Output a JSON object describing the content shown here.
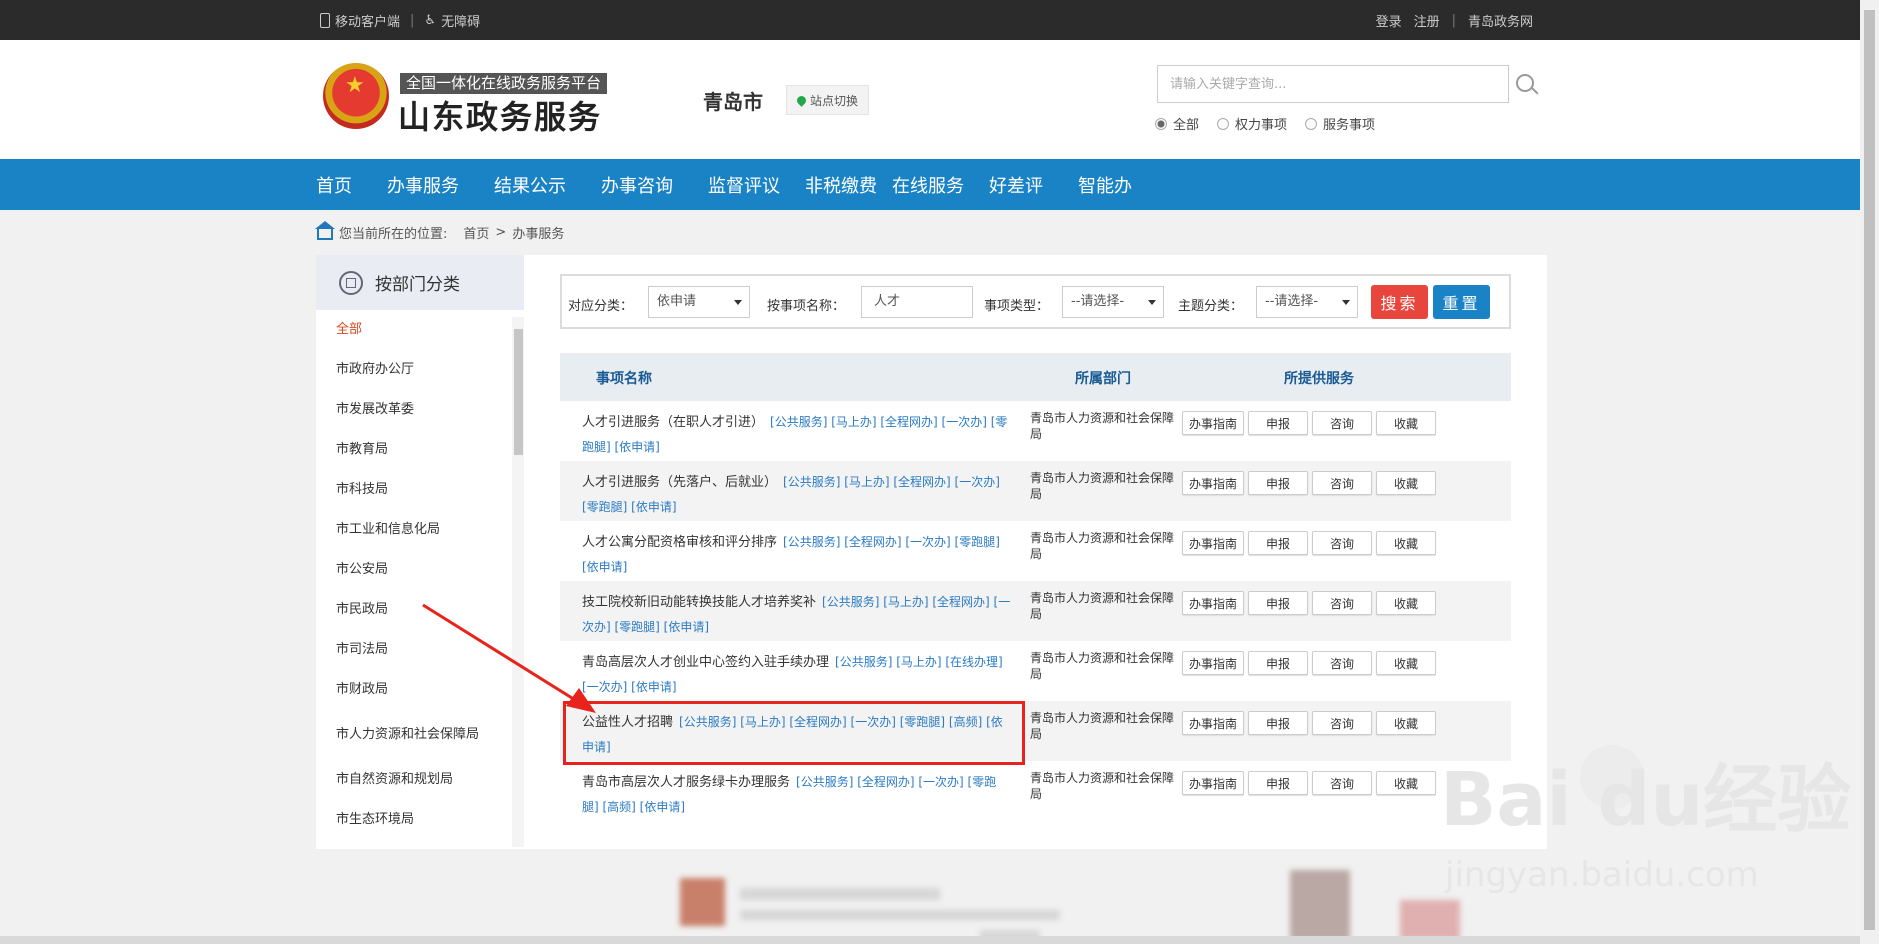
{
  "topbar": {
    "mobile_label": "移动客户端",
    "accessibility_label": "无障碍",
    "login": "登录",
    "register": "注册",
    "portal": "青岛政务网"
  },
  "header": {
    "logo_sub": "全国一体化在线政务服务平台",
    "logo_main": "山东政务服务",
    "city": "青岛市",
    "site_switch": "站点切换",
    "search_placeholder": "请输入关键字查询...",
    "radios": [
      {
        "label": "全部",
        "checked": true
      },
      {
        "label": "权力事项",
        "checked": false
      },
      {
        "label": "服务事项",
        "checked": false
      }
    ]
  },
  "nav": [
    "首页",
    "办事服务",
    "结果公示",
    "办事咨询",
    "监督评议",
    "非税缴费",
    "在线服务",
    "好差评",
    "智能办"
  ],
  "breadcrumb": {
    "prefix": "您当前所在的位置:",
    "home": "首页",
    "sep": ">",
    "current": "办事服务"
  },
  "sidebar": {
    "title": "按部门分类",
    "items": [
      "全部",
      "市政府办公厅",
      "市发展改革委",
      "市教育局",
      "市科技局",
      "市工业和信息化局",
      "市公安局",
      "市民政局",
      "市司法局",
      "市财政局",
      "市人力资源和社会保障局",
      "市自然资源和规划局",
      "市生态环境局"
    ]
  },
  "filter": {
    "category_label": "对应分类：",
    "category_value": "依申请",
    "name_label": "按事项名称：",
    "name_value": "人才",
    "type_label": "事项类型：",
    "type_value": "--请选择-",
    "theme_label": "主题分类：",
    "theme_value": "--请选择-",
    "search_btn": "搜索",
    "reset_btn": "重置"
  },
  "table": {
    "headers": [
      "事项名称",
      "所属部门",
      "所提供服务"
    ],
    "buttons": [
      "办事指南",
      "申报",
      "咨询",
      "收藏"
    ],
    "rows": [
      {
        "name": "人才引进服务（在职人才引进）",
        "tags": "[公共服务] [马上办] [全程网办] [一次办] [零跑腿] [依申请]",
        "dept": "青岛市人力资源和社会保障局"
      },
      {
        "name": "人才引进服务（先落户、后就业）",
        "tags": "[公共服务] [马上办] [全程网办] [一次办] [零跑腿] [依申请]",
        "dept": "青岛市人力资源和社会保障局"
      },
      {
        "name": "人才公寓分配资格审核和评分排序",
        "tags": "[公共服务] [全程网办] [一次办] [零跑腿] [依申请]",
        "dept": "青岛市人力资源和社会保障局"
      },
      {
        "name": "技工院校新旧动能转换技能人才培养奖补",
        "tags": "[公共服务] [马上办] [全程网办] [一次办] [零跑腿] [依申请]",
        "dept": "青岛市人力资源和社会保障局"
      },
      {
        "name": "青岛高层次人才创业中心签约入驻手续办理",
        "tags": "[公共服务] [马上办] [在线办理] [一次办] [依申请]",
        "dept": "青岛市人力资源和社会保障局"
      },
      {
        "name": "公益性人才招聘",
        "tags": "[公共服务] [马上办] [全程网办] [一次办] [零跑腿] [高频] [依申请]",
        "dept": "青岛市人力资源和社会保障局"
      },
      {
        "name": "青岛市高层次人才服务绿卡办理服务",
        "tags": "[公共服务] [全程网办] [一次办] [零跑腿] [高频] [依申请]",
        "dept": "青岛市人力资源和社会保障局"
      }
    ]
  },
  "watermark": {
    "main": "Bai du经验",
    "sub": "jingyan.baidu.com"
  },
  "colors": {
    "nav": "#1a83c6",
    "search_btn": "#e8453c",
    "highlight": "#e8231c",
    "tag": "#2b7bc4"
  }
}
